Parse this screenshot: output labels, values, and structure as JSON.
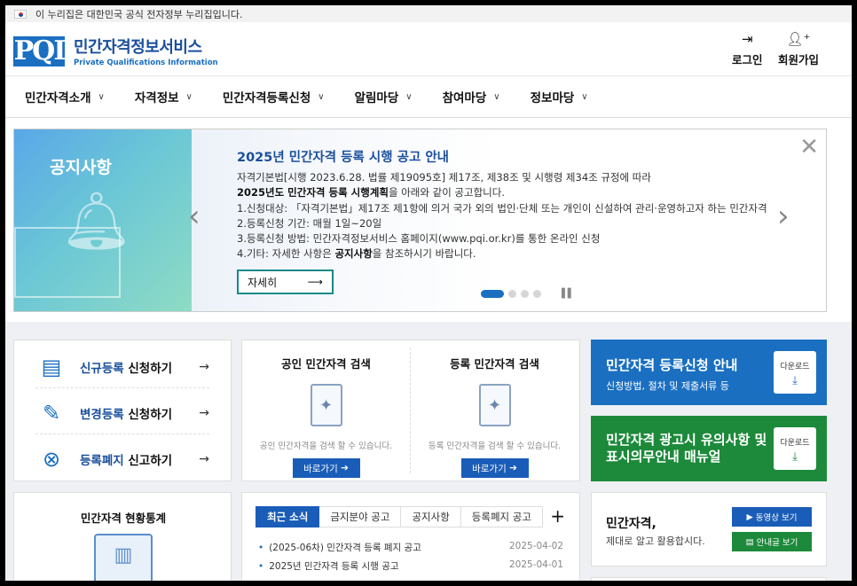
{
  "gov_banner": {
    "text": "이 누리집은 대한민국 공식 전자정부 누리집입니다."
  },
  "logo": {
    "mark": "PQI",
    "title": "민간자격정보서비스",
    "subtitle": "Private Qualifications Information"
  },
  "util": {
    "login": "로그인",
    "signup": "회원가입"
  },
  "nav": [
    {
      "label": "민간자격소개"
    },
    {
      "label": "자격정보"
    },
    {
      "label": "민간자격등록신청"
    },
    {
      "label": "알림마당"
    },
    {
      "label": "참여마당"
    },
    {
      "label": "정보마당"
    }
  ],
  "banner": {
    "tile_title": "공지사항",
    "title": "2025년 민간자격 등록 시행 공고 안내",
    "line1": "자격기본법[시행 2023.6.28. 법률 제19095호] 제17조, 제38조 및 시행령 제34조 규정에 따라",
    "line2_bold": "2025년도 민간자격 등록 시행계획",
    "line2_rest": "을 아래와 같이 공고합니다.",
    "line3": "1.신청대상: 「자격기본법」제17조 제1항에 의거 국가 외의 법인·단체 또는 개인이 신설하여 관리·운영하고자 하는 민간자격",
    "line4": "2.등록신청 기간: 매월 1일~20일",
    "line5": "3.등록신청 방법: 민간자격정보서비스 홈페이지(www.pqi.or.kr)를 통한 온라인 신청",
    "line6_a": "4.기타: 자세한 사항은 ",
    "line6_bold": "공지사항",
    "line6_b": "을 참조하시기 바랍니다.",
    "more_label": "자세히",
    "slide_count": 4,
    "active_slide": 1
  },
  "registration": [
    {
      "highlight": "신규등록",
      "rest": " 신청하기"
    },
    {
      "highlight": "변경등록",
      "rest": " 신청하기"
    },
    {
      "highlight": "등록폐지",
      "rest": " 신고하기"
    }
  ],
  "search": [
    {
      "title": "공인 민간자격 검색",
      "desc": "공인 민간자격을 검색 할 수 있습니다.",
      "button": "바로가기"
    },
    {
      "title": "등록 민간자격 검색",
      "desc": "등록 민간자격을 검색 할 수 있습니다.",
      "button": "바로가기"
    }
  ],
  "promo": [
    {
      "title": "민간자격 등록신청 안내",
      "sub": "신청방법, 절차 및 제출서류 등",
      "download": "다운로드",
      "color": "#1a6fc1"
    },
    {
      "title_line1": "민간자격 광고시 유의사항 및",
      "title_line2": "표시의무안내 매뉴얼",
      "download": "다운로드",
      "color": "#1c8a3a"
    }
  ],
  "stats": {
    "title": "민간자격 현황통계"
  },
  "news": {
    "tabs": [
      "최근 소식",
      "금지분야 공고",
      "공지사항",
      "등록폐지 공고"
    ],
    "items": [
      {
        "title": "(2025-06차) 민간자격 등록 폐지 공고",
        "date": "2025-04-02"
      },
      {
        "title": "2025년 민간자격 등록 시행 공고",
        "date": "2025-04-01"
      }
    ]
  },
  "guide": {
    "title": "민간자격,",
    "sub": "제대로 알고 활용합시다.",
    "video_btn": "동영상 보기",
    "guide_btn": "안내글 보기"
  }
}
